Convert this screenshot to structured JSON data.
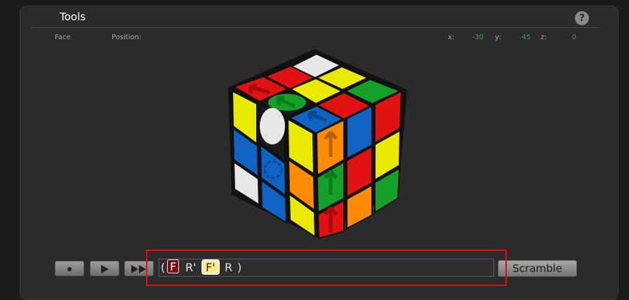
{
  "panel": {
    "title": "Tools",
    "help_glyph": "?"
  },
  "info": {
    "face_label": "Face",
    "position_label": "Position:",
    "x_label": "x:",
    "x_value": "-30",
    "y_label": "y:",
    "y_value": "-45",
    "z_label": "z:",
    "z_value": "0"
  },
  "colors": {
    "red": "#e01212",
    "green": "#15a02a",
    "blue": "#0f63c4",
    "yellow": "#eaea00",
    "orange": "#ff8c00",
    "white": "#e8e8e8"
  },
  "controls": {
    "record_icon": "record-icon",
    "play_icon": "play-icon",
    "fastforward_icon": "fast-forward-icon"
  },
  "sequence": {
    "open_paren": "(",
    "moves": [
      "F",
      "R'",
      "F'",
      "R"
    ],
    "close_paren": ")",
    "current_index": 0,
    "next_index": 2
  },
  "scramble_label": "Scramble"
}
